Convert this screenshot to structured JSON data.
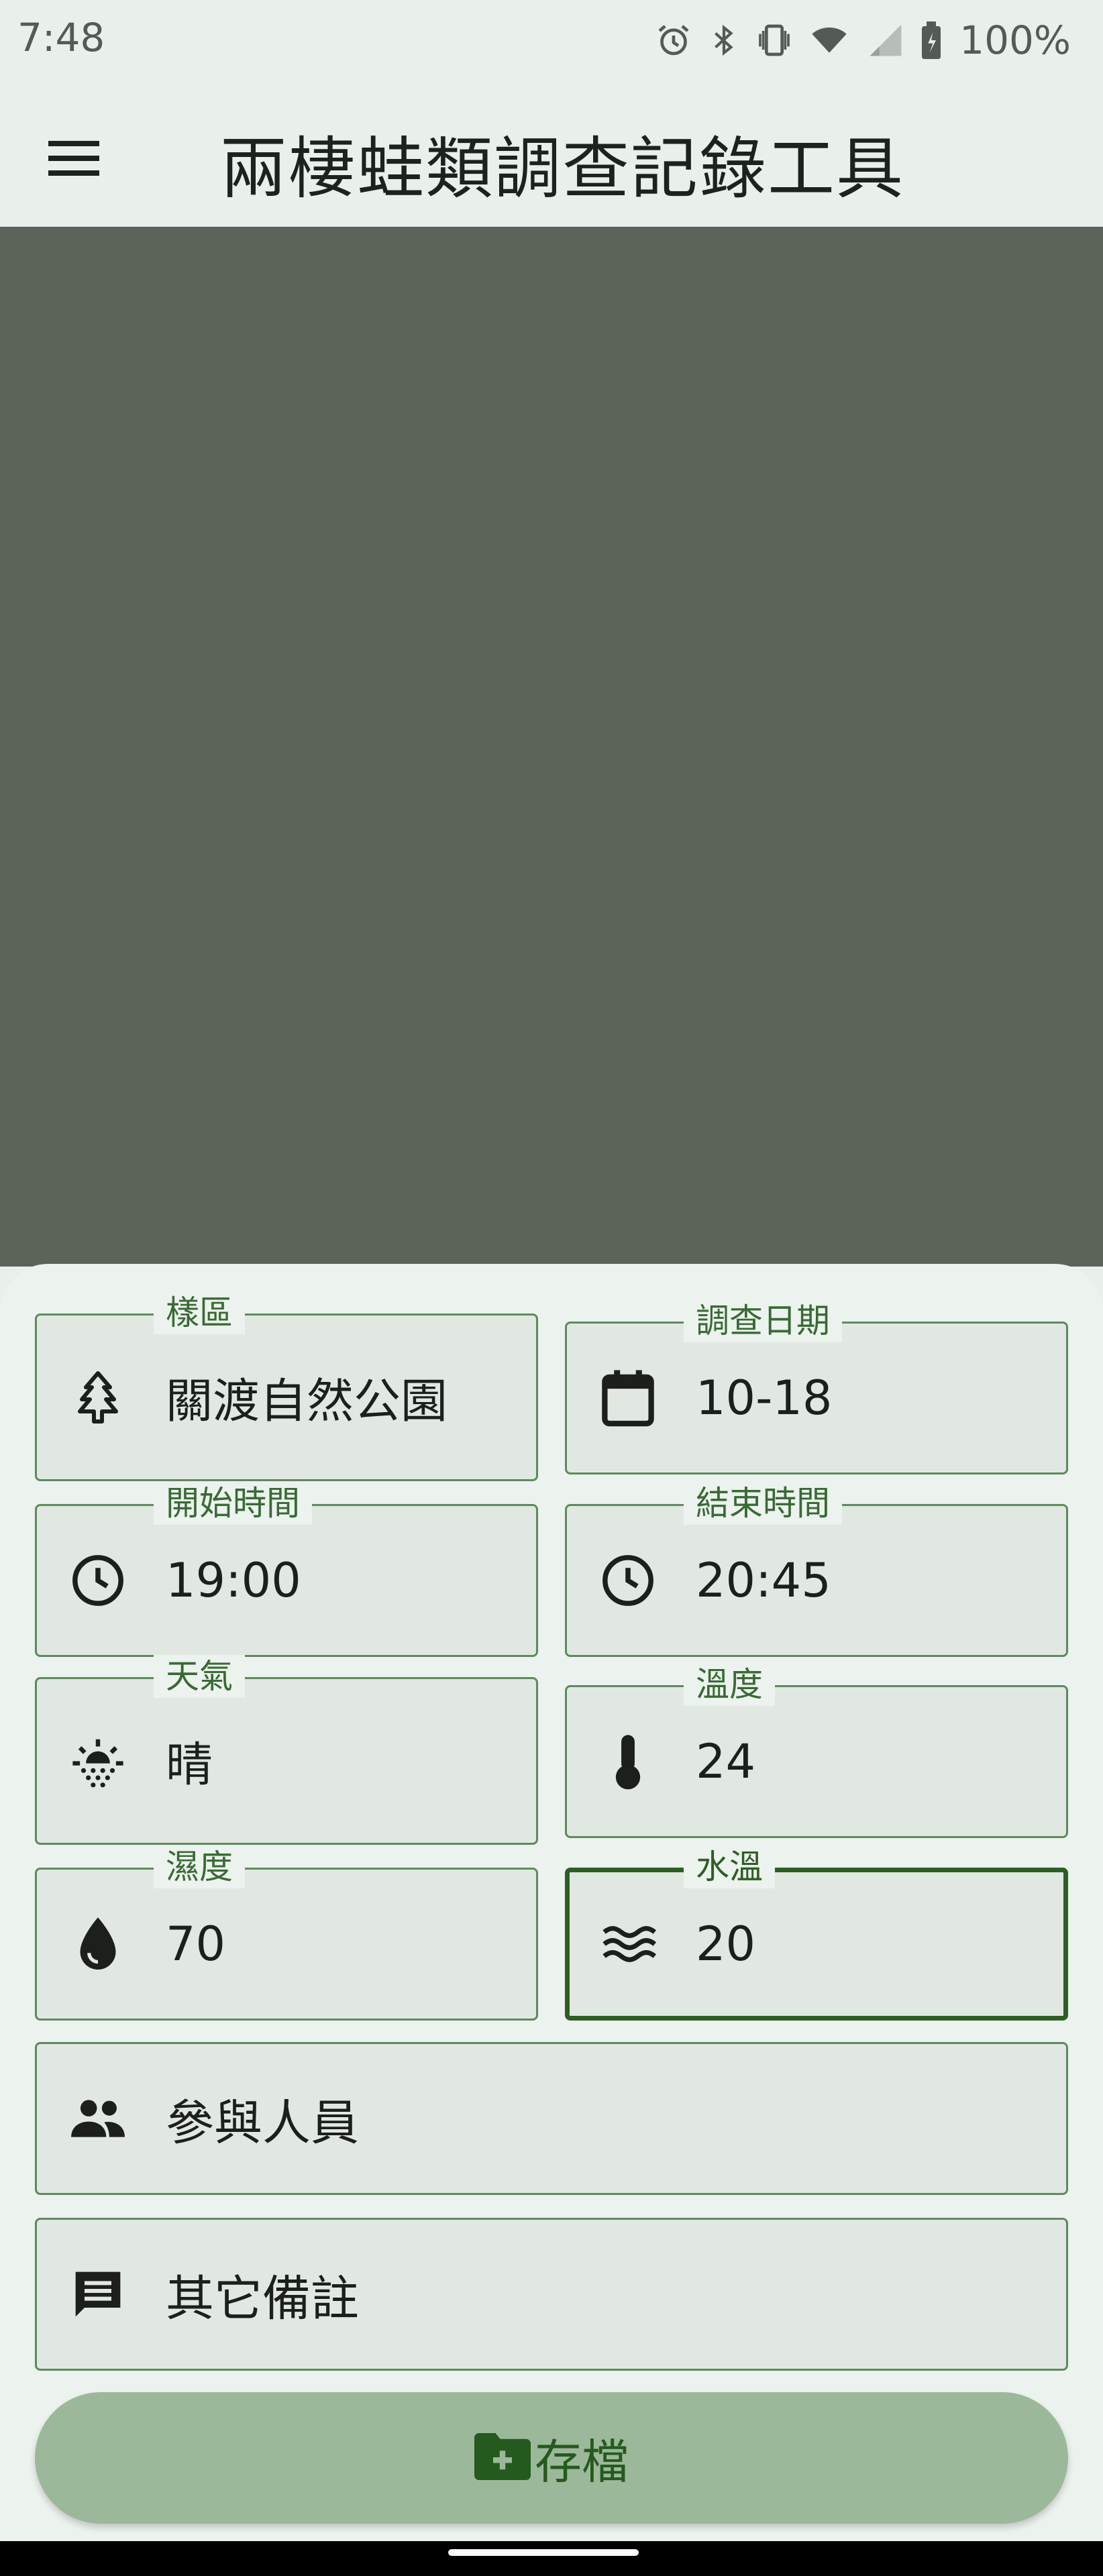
{
  "status_bar": {
    "time": "7:48",
    "battery": "100%",
    "icons": [
      "alarm-icon",
      "bluetooth-icon",
      "vibrate-icon",
      "wifi-icon",
      "cell-signal-icon",
      "battery-icon"
    ]
  },
  "app_bar": {
    "title": "兩棲蛙類調查記錄工具",
    "menu_icon": "menu-icon"
  },
  "form": {
    "sample_area": {
      "label": "樣區",
      "value": "關渡自然公園",
      "icon": "tree-icon"
    },
    "survey_date": {
      "label": "調查日期",
      "value": "10-18",
      "icon": "calendar-icon"
    },
    "start_time": {
      "label": "開始時間",
      "value": "19:00",
      "icon": "clock-icon"
    },
    "end_time": {
      "label": "結束時間",
      "value": "20:45",
      "icon": "clock-icon"
    },
    "weather": {
      "label": "天氣",
      "value": "晴",
      "icon": "weather-sun-icon"
    },
    "temperature": {
      "label": "溫度",
      "value": "24",
      "icon": "thermometer-icon"
    },
    "humidity": {
      "label": "濕度",
      "value": "70",
      "icon": "water-drop-icon"
    },
    "water_temp": {
      "label": "水溫",
      "value": "20",
      "icon": "waves-icon"
    },
    "participants": {
      "placeholder": "參與人員",
      "icon": "people-icon"
    },
    "notes": {
      "placeholder": "其它備註",
      "icon": "comment-icon"
    }
  },
  "save_button": {
    "label": "存檔",
    "icon": "create-folder-icon"
  },
  "colors": {
    "accent": "#2d5e24",
    "label": "#386a34",
    "field_border": "#5e8a5e",
    "field_bg": "#e1e8e1",
    "sheet_bg": "#ecf2ed",
    "scrim": "#5c6359",
    "button_bg": "#9cb89a"
  }
}
